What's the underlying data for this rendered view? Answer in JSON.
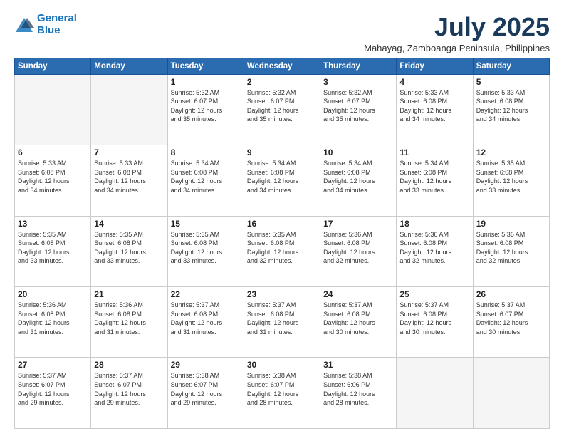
{
  "logo": {
    "line1": "General",
    "line2": "Blue"
  },
  "title": "July 2025",
  "subtitle": "Mahayag, Zamboanga Peninsula, Philippines",
  "days_header": [
    "Sunday",
    "Monday",
    "Tuesday",
    "Wednesday",
    "Thursday",
    "Friday",
    "Saturday"
  ],
  "weeks": [
    [
      {
        "day": "",
        "info": ""
      },
      {
        "day": "",
        "info": ""
      },
      {
        "day": "1",
        "info": "Sunrise: 5:32 AM\nSunset: 6:07 PM\nDaylight: 12 hours\nand 35 minutes."
      },
      {
        "day": "2",
        "info": "Sunrise: 5:32 AM\nSunset: 6:07 PM\nDaylight: 12 hours\nand 35 minutes."
      },
      {
        "day": "3",
        "info": "Sunrise: 5:32 AM\nSunset: 6:07 PM\nDaylight: 12 hours\nand 35 minutes."
      },
      {
        "day": "4",
        "info": "Sunrise: 5:33 AM\nSunset: 6:08 PM\nDaylight: 12 hours\nand 34 minutes."
      },
      {
        "day": "5",
        "info": "Sunrise: 5:33 AM\nSunset: 6:08 PM\nDaylight: 12 hours\nand 34 minutes."
      }
    ],
    [
      {
        "day": "6",
        "info": "Sunrise: 5:33 AM\nSunset: 6:08 PM\nDaylight: 12 hours\nand 34 minutes."
      },
      {
        "day": "7",
        "info": "Sunrise: 5:33 AM\nSunset: 6:08 PM\nDaylight: 12 hours\nand 34 minutes."
      },
      {
        "day": "8",
        "info": "Sunrise: 5:34 AM\nSunset: 6:08 PM\nDaylight: 12 hours\nand 34 minutes."
      },
      {
        "day": "9",
        "info": "Sunrise: 5:34 AM\nSunset: 6:08 PM\nDaylight: 12 hours\nand 34 minutes."
      },
      {
        "day": "10",
        "info": "Sunrise: 5:34 AM\nSunset: 6:08 PM\nDaylight: 12 hours\nand 34 minutes."
      },
      {
        "day": "11",
        "info": "Sunrise: 5:34 AM\nSunset: 6:08 PM\nDaylight: 12 hours\nand 33 minutes."
      },
      {
        "day": "12",
        "info": "Sunrise: 5:35 AM\nSunset: 6:08 PM\nDaylight: 12 hours\nand 33 minutes."
      }
    ],
    [
      {
        "day": "13",
        "info": "Sunrise: 5:35 AM\nSunset: 6:08 PM\nDaylight: 12 hours\nand 33 minutes."
      },
      {
        "day": "14",
        "info": "Sunrise: 5:35 AM\nSunset: 6:08 PM\nDaylight: 12 hours\nand 33 minutes."
      },
      {
        "day": "15",
        "info": "Sunrise: 5:35 AM\nSunset: 6:08 PM\nDaylight: 12 hours\nand 33 minutes."
      },
      {
        "day": "16",
        "info": "Sunrise: 5:35 AM\nSunset: 6:08 PM\nDaylight: 12 hours\nand 32 minutes."
      },
      {
        "day": "17",
        "info": "Sunrise: 5:36 AM\nSunset: 6:08 PM\nDaylight: 12 hours\nand 32 minutes."
      },
      {
        "day": "18",
        "info": "Sunrise: 5:36 AM\nSunset: 6:08 PM\nDaylight: 12 hours\nand 32 minutes."
      },
      {
        "day": "19",
        "info": "Sunrise: 5:36 AM\nSunset: 6:08 PM\nDaylight: 12 hours\nand 32 minutes."
      }
    ],
    [
      {
        "day": "20",
        "info": "Sunrise: 5:36 AM\nSunset: 6:08 PM\nDaylight: 12 hours\nand 31 minutes."
      },
      {
        "day": "21",
        "info": "Sunrise: 5:36 AM\nSunset: 6:08 PM\nDaylight: 12 hours\nand 31 minutes."
      },
      {
        "day": "22",
        "info": "Sunrise: 5:37 AM\nSunset: 6:08 PM\nDaylight: 12 hours\nand 31 minutes."
      },
      {
        "day": "23",
        "info": "Sunrise: 5:37 AM\nSunset: 6:08 PM\nDaylight: 12 hours\nand 31 minutes."
      },
      {
        "day": "24",
        "info": "Sunrise: 5:37 AM\nSunset: 6:08 PM\nDaylight: 12 hours\nand 30 minutes."
      },
      {
        "day": "25",
        "info": "Sunrise: 5:37 AM\nSunset: 6:08 PM\nDaylight: 12 hours\nand 30 minutes."
      },
      {
        "day": "26",
        "info": "Sunrise: 5:37 AM\nSunset: 6:07 PM\nDaylight: 12 hours\nand 30 minutes."
      }
    ],
    [
      {
        "day": "27",
        "info": "Sunrise: 5:37 AM\nSunset: 6:07 PM\nDaylight: 12 hours\nand 29 minutes."
      },
      {
        "day": "28",
        "info": "Sunrise: 5:37 AM\nSunset: 6:07 PM\nDaylight: 12 hours\nand 29 minutes."
      },
      {
        "day": "29",
        "info": "Sunrise: 5:38 AM\nSunset: 6:07 PM\nDaylight: 12 hours\nand 29 minutes."
      },
      {
        "day": "30",
        "info": "Sunrise: 5:38 AM\nSunset: 6:07 PM\nDaylight: 12 hours\nand 28 minutes."
      },
      {
        "day": "31",
        "info": "Sunrise: 5:38 AM\nSunset: 6:06 PM\nDaylight: 12 hours\nand 28 minutes."
      },
      {
        "day": "",
        "info": ""
      },
      {
        "day": "",
        "info": ""
      }
    ]
  ]
}
